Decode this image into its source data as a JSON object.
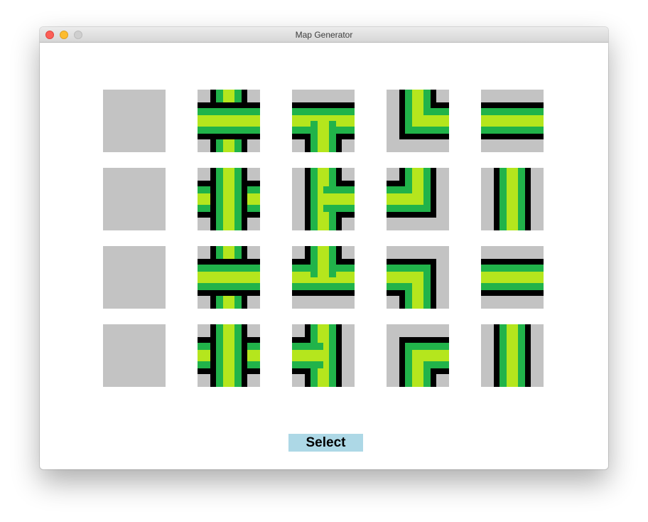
{
  "window": {
    "title": "Map Generator",
    "controls": [
      "close",
      "minimize",
      "zoom"
    ]
  },
  "colors": {
    "tile_background": "#c3c3c3",
    "road_outline": "#000000",
    "road_edge": "#21b34a",
    "road_center": "#b5e61d",
    "button_background": "#add8e6"
  },
  "grid": {
    "rows": [
      [
        "blank-tile",
        "crossroad-tile",
        "t-junction-tile",
        "corner-tile",
        "straight-horizontal-tile"
      ],
      [
        "blank-tile",
        "crossroad-tile",
        "t-junction-tile",
        "corner-tile",
        "straight-vertical-tile"
      ],
      [
        "blank-tile",
        "crossroad-tile",
        "t-junction-tile",
        "corner-tile",
        "straight-horizontal-tile"
      ],
      [
        "blank-tile",
        "crossroad-tile",
        "t-junction-tile",
        "corner-tile",
        "straight-vertical-tile"
      ]
    ]
  },
  "select_button": {
    "label": "Select"
  }
}
